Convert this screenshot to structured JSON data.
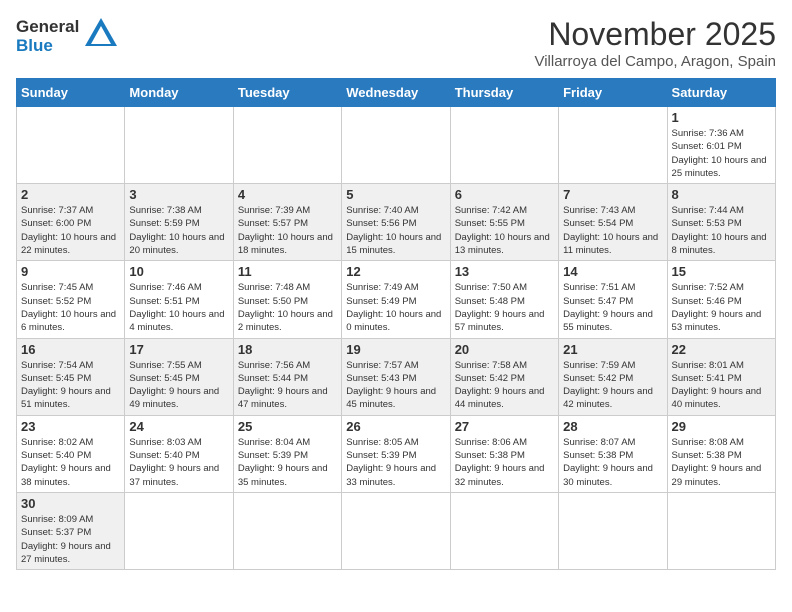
{
  "logo": {
    "text_general": "General",
    "text_blue": "Blue"
  },
  "header": {
    "month": "November 2025",
    "location": "Villarroya del Campo, Aragon, Spain"
  },
  "weekdays": [
    "Sunday",
    "Monday",
    "Tuesday",
    "Wednesday",
    "Thursday",
    "Friday",
    "Saturday"
  ],
  "weeks": [
    [
      {
        "day": "",
        "info": ""
      },
      {
        "day": "",
        "info": ""
      },
      {
        "day": "",
        "info": ""
      },
      {
        "day": "",
        "info": ""
      },
      {
        "day": "",
        "info": ""
      },
      {
        "day": "",
        "info": ""
      },
      {
        "day": "1",
        "info": "Sunrise: 7:36 AM\nSunset: 6:01 PM\nDaylight: 10 hours and 25 minutes."
      }
    ],
    [
      {
        "day": "2",
        "info": "Sunrise: 7:37 AM\nSunset: 6:00 PM\nDaylight: 10 hours and 22 minutes."
      },
      {
        "day": "3",
        "info": "Sunrise: 7:38 AM\nSunset: 5:59 PM\nDaylight: 10 hours and 20 minutes."
      },
      {
        "day": "4",
        "info": "Sunrise: 7:39 AM\nSunset: 5:57 PM\nDaylight: 10 hours and 18 minutes."
      },
      {
        "day": "5",
        "info": "Sunrise: 7:40 AM\nSunset: 5:56 PM\nDaylight: 10 hours and 15 minutes."
      },
      {
        "day": "6",
        "info": "Sunrise: 7:42 AM\nSunset: 5:55 PM\nDaylight: 10 hours and 13 minutes."
      },
      {
        "day": "7",
        "info": "Sunrise: 7:43 AM\nSunset: 5:54 PM\nDaylight: 10 hours and 11 minutes."
      },
      {
        "day": "8",
        "info": "Sunrise: 7:44 AM\nSunset: 5:53 PM\nDaylight: 10 hours and 8 minutes."
      }
    ],
    [
      {
        "day": "9",
        "info": "Sunrise: 7:45 AM\nSunset: 5:52 PM\nDaylight: 10 hours and 6 minutes."
      },
      {
        "day": "10",
        "info": "Sunrise: 7:46 AM\nSunset: 5:51 PM\nDaylight: 10 hours and 4 minutes."
      },
      {
        "day": "11",
        "info": "Sunrise: 7:48 AM\nSunset: 5:50 PM\nDaylight: 10 hours and 2 minutes."
      },
      {
        "day": "12",
        "info": "Sunrise: 7:49 AM\nSunset: 5:49 PM\nDaylight: 10 hours and 0 minutes."
      },
      {
        "day": "13",
        "info": "Sunrise: 7:50 AM\nSunset: 5:48 PM\nDaylight: 9 hours and 57 minutes."
      },
      {
        "day": "14",
        "info": "Sunrise: 7:51 AM\nSunset: 5:47 PM\nDaylight: 9 hours and 55 minutes."
      },
      {
        "day": "15",
        "info": "Sunrise: 7:52 AM\nSunset: 5:46 PM\nDaylight: 9 hours and 53 minutes."
      }
    ],
    [
      {
        "day": "16",
        "info": "Sunrise: 7:54 AM\nSunset: 5:45 PM\nDaylight: 9 hours and 51 minutes."
      },
      {
        "day": "17",
        "info": "Sunrise: 7:55 AM\nSunset: 5:45 PM\nDaylight: 9 hours and 49 minutes."
      },
      {
        "day": "18",
        "info": "Sunrise: 7:56 AM\nSunset: 5:44 PM\nDaylight: 9 hours and 47 minutes."
      },
      {
        "day": "19",
        "info": "Sunrise: 7:57 AM\nSunset: 5:43 PM\nDaylight: 9 hours and 45 minutes."
      },
      {
        "day": "20",
        "info": "Sunrise: 7:58 AM\nSunset: 5:42 PM\nDaylight: 9 hours and 44 minutes."
      },
      {
        "day": "21",
        "info": "Sunrise: 7:59 AM\nSunset: 5:42 PM\nDaylight: 9 hours and 42 minutes."
      },
      {
        "day": "22",
        "info": "Sunrise: 8:01 AM\nSunset: 5:41 PM\nDaylight: 9 hours and 40 minutes."
      }
    ],
    [
      {
        "day": "23",
        "info": "Sunrise: 8:02 AM\nSunset: 5:40 PM\nDaylight: 9 hours and 38 minutes."
      },
      {
        "day": "24",
        "info": "Sunrise: 8:03 AM\nSunset: 5:40 PM\nDaylight: 9 hours and 37 minutes."
      },
      {
        "day": "25",
        "info": "Sunrise: 8:04 AM\nSunset: 5:39 PM\nDaylight: 9 hours and 35 minutes."
      },
      {
        "day": "26",
        "info": "Sunrise: 8:05 AM\nSunset: 5:39 PM\nDaylight: 9 hours and 33 minutes."
      },
      {
        "day": "27",
        "info": "Sunrise: 8:06 AM\nSunset: 5:38 PM\nDaylight: 9 hours and 32 minutes."
      },
      {
        "day": "28",
        "info": "Sunrise: 8:07 AM\nSunset: 5:38 PM\nDaylight: 9 hours and 30 minutes."
      },
      {
        "day": "29",
        "info": "Sunrise: 8:08 AM\nSunset: 5:38 PM\nDaylight: 9 hours and 29 minutes."
      }
    ],
    [
      {
        "day": "30",
        "info": "Sunrise: 8:09 AM\nSunset: 5:37 PM\nDaylight: 9 hours and 27 minutes."
      },
      {
        "day": "",
        "info": ""
      },
      {
        "day": "",
        "info": ""
      },
      {
        "day": "",
        "info": ""
      },
      {
        "day": "",
        "info": ""
      },
      {
        "day": "",
        "info": ""
      },
      {
        "day": "",
        "info": ""
      }
    ]
  ]
}
